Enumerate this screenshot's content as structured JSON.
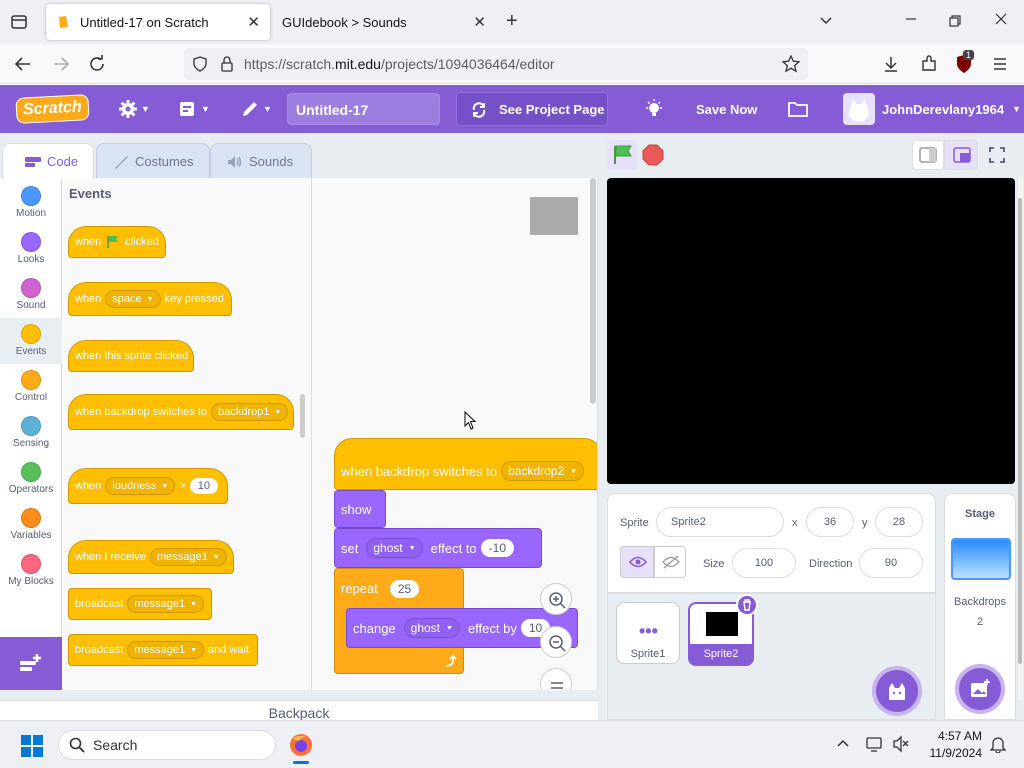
{
  "browser": {
    "tabs": [
      {
        "label": "Untitled-17 on Scratch",
        "active": true
      },
      {
        "label": "GUIdebook > Sounds",
        "active": false
      }
    ],
    "url_prefix": "https://scratch.",
    "url_domain": "mit.edu",
    "url_rest": "/projects/1094036464/editor",
    "ext_badge": "1"
  },
  "menubar": {
    "logo": "Scratch",
    "project_title": "Untitled-17",
    "see_project_label": "See Project Page",
    "save_label": "Save Now",
    "username": "JohnDerevlany1964"
  },
  "editor_tabs": [
    {
      "label": "Code",
      "active": true
    },
    {
      "label": "Costumes",
      "active": false
    },
    {
      "label": "Sounds",
      "active": false
    }
  ],
  "categories": [
    {
      "label": "Motion",
      "color": "#4c97ff"
    },
    {
      "label": "Looks",
      "color": "#9966ff"
    },
    {
      "label": "Sound",
      "color": "#cf63cf"
    },
    {
      "label": "Events",
      "color": "#ffbf00"
    },
    {
      "label": "Control",
      "color": "#ffab19"
    },
    {
      "label": "Sensing",
      "color": "#5cb1d6"
    },
    {
      "label": "Operators",
      "color": "#59c059"
    },
    {
      "label": "Variables",
      "color": "#ff8c1a"
    },
    {
      "label": "My Blocks",
      "color": "#ff6680"
    }
  ],
  "palette": {
    "heading": "Events",
    "when_flag": {
      "pre": "when",
      "post": "clicked"
    },
    "when_key": {
      "pre": "when",
      "key": "space",
      "post": "key pressed"
    },
    "when_sprite_clicked": "when this sprite clicked",
    "when_backdrop": {
      "pre": "when backdrop switches to",
      "value": "backdrop1"
    },
    "when_loudness": {
      "pre": "when",
      "sensor": "loudness",
      "op": ">",
      "value": "10"
    },
    "when_receive": {
      "pre": "when I receive",
      "msg": "message1"
    },
    "broadcast": {
      "pre": "broadcast",
      "msg": "message1"
    },
    "broadcast_wait": {
      "pre": "broadcast",
      "msg": "message1",
      "post": "and wait"
    }
  },
  "script": {
    "hat": {
      "pre": "when backdrop switches to",
      "value": "backdrop2"
    },
    "show": "show",
    "set_effect": {
      "pre": "set",
      "effect": "ghost",
      "mid": "effect to",
      "value": "-10"
    },
    "repeat": {
      "label": "repeat",
      "value": "25"
    },
    "change_effect": {
      "pre": "change",
      "effect": "ghost",
      "mid": "effect by",
      "value": "10"
    }
  },
  "sprite_info": {
    "sprite_label": "Sprite",
    "sprite_name": "Sprite2",
    "x_label": "x",
    "x": "36",
    "y_label": "y",
    "y": "28",
    "size_label": "Size",
    "size": "100",
    "direction_label": "Direction",
    "direction": "90"
  },
  "sprites": [
    {
      "name": "Sprite1",
      "selected": false
    },
    {
      "name": "Sprite2",
      "selected": true
    }
  ],
  "stage_panel": {
    "heading": "Stage",
    "backdrops_label": "Backdrops",
    "backdrops_count": "2"
  },
  "backpack_label": "Backpack",
  "taskbar": {
    "search_placeholder": "Search",
    "time": "4:57 AM",
    "date": "11/9/2024"
  },
  "colors": {
    "scratch_purple": "#855cd6",
    "events": "#ffbf00",
    "looks": "#9966ff",
    "control": "#ffab19"
  }
}
